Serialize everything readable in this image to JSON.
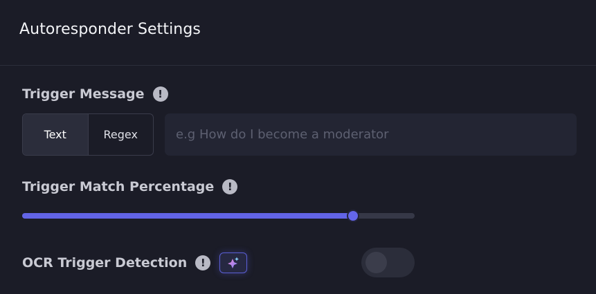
{
  "header": {
    "title": "Autoresponder Settings"
  },
  "trigger_message": {
    "label": "Trigger Message",
    "info_icon": "info-icon",
    "modes": [
      "Text",
      "Regex"
    ],
    "active_mode": "Text",
    "input": {
      "placeholder": "e.g How do I become a moderator",
      "value": ""
    }
  },
  "trigger_match": {
    "label": "Trigger Match Percentage",
    "info_icon": "info-icon",
    "value_fraction": 0.843
  },
  "ocr_detection": {
    "label": "OCR Trigger Detection",
    "info_icon": "info-icon",
    "badge_icon": "sparkles-icon",
    "enabled": false
  },
  "colors": {
    "background": "#1b1c27",
    "accent": "#6264e6",
    "input_bg": "#232533"
  }
}
